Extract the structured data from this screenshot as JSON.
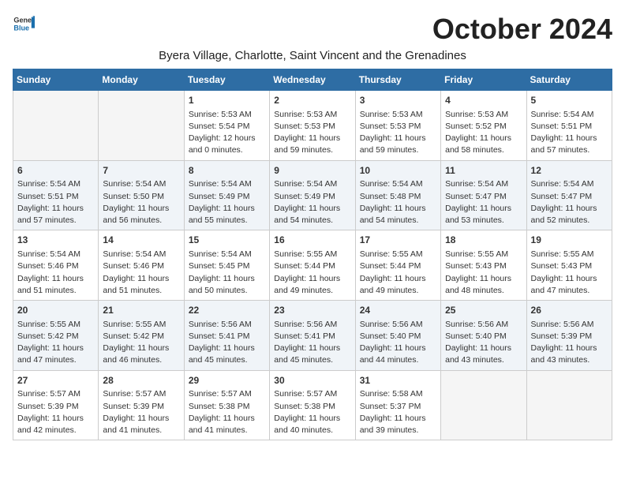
{
  "logo": {
    "general": "General",
    "blue": "Blue"
  },
  "title": "October 2024",
  "subtitle": "Byera Village, Charlotte, Saint Vincent and the Grenadines",
  "days_header": [
    "Sunday",
    "Monday",
    "Tuesday",
    "Wednesday",
    "Thursday",
    "Friday",
    "Saturday"
  ],
  "weeks": [
    [
      {
        "day": "",
        "info": ""
      },
      {
        "day": "",
        "info": ""
      },
      {
        "day": "1",
        "info": "Sunrise: 5:53 AM\nSunset: 5:54 PM\nDaylight: 12 hours and 0 minutes."
      },
      {
        "day": "2",
        "info": "Sunrise: 5:53 AM\nSunset: 5:53 PM\nDaylight: 11 hours and 59 minutes."
      },
      {
        "day": "3",
        "info": "Sunrise: 5:53 AM\nSunset: 5:53 PM\nDaylight: 11 hours and 59 minutes."
      },
      {
        "day": "4",
        "info": "Sunrise: 5:53 AM\nSunset: 5:52 PM\nDaylight: 11 hours and 58 minutes."
      },
      {
        "day": "5",
        "info": "Sunrise: 5:54 AM\nSunset: 5:51 PM\nDaylight: 11 hours and 57 minutes."
      }
    ],
    [
      {
        "day": "6",
        "info": "Sunrise: 5:54 AM\nSunset: 5:51 PM\nDaylight: 11 hours and 57 minutes."
      },
      {
        "day": "7",
        "info": "Sunrise: 5:54 AM\nSunset: 5:50 PM\nDaylight: 11 hours and 56 minutes."
      },
      {
        "day": "8",
        "info": "Sunrise: 5:54 AM\nSunset: 5:49 PM\nDaylight: 11 hours and 55 minutes."
      },
      {
        "day": "9",
        "info": "Sunrise: 5:54 AM\nSunset: 5:49 PM\nDaylight: 11 hours and 54 minutes."
      },
      {
        "day": "10",
        "info": "Sunrise: 5:54 AM\nSunset: 5:48 PM\nDaylight: 11 hours and 54 minutes."
      },
      {
        "day": "11",
        "info": "Sunrise: 5:54 AM\nSunset: 5:47 PM\nDaylight: 11 hours and 53 minutes."
      },
      {
        "day": "12",
        "info": "Sunrise: 5:54 AM\nSunset: 5:47 PM\nDaylight: 11 hours and 52 minutes."
      }
    ],
    [
      {
        "day": "13",
        "info": "Sunrise: 5:54 AM\nSunset: 5:46 PM\nDaylight: 11 hours and 51 minutes."
      },
      {
        "day": "14",
        "info": "Sunrise: 5:54 AM\nSunset: 5:46 PM\nDaylight: 11 hours and 51 minutes."
      },
      {
        "day": "15",
        "info": "Sunrise: 5:54 AM\nSunset: 5:45 PM\nDaylight: 11 hours and 50 minutes."
      },
      {
        "day": "16",
        "info": "Sunrise: 5:55 AM\nSunset: 5:44 PM\nDaylight: 11 hours and 49 minutes."
      },
      {
        "day": "17",
        "info": "Sunrise: 5:55 AM\nSunset: 5:44 PM\nDaylight: 11 hours and 49 minutes."
      },
      {
        "day": "18",
        "info": "Sunrise: 5:55 AM\nSunset: 5:43 PM\nDaylight: 11 hours and 48 minutes."
      },
      {
        "day": "19",
        "info": "Sunrise: 5:55 AM\nSunset: 5:43 PM\nDaylight: 11 hours and 47 minutes."
      }
    ],
    [
      {
        "day": "20",
        "info": "Sunrise: 5:55 AM\nSunset: 5:42 PM\nDaylight: 11 hours and 47 minutes."
      },
      {
        "day": "21",
        "info": "Sunrise: 5:55 AM\nSunset: 5:42 PM\nDaylight: 11 hours and 46 minutes."
      },
      {
        "day": "22",
        "info": "Sunrise: 5:56 AM\nSunset: 5:41 PM\nDaylight: 11 hours and 45 minutes."
      },
      {
        "day": "23",
        "info": "Sunrise: 5:56 AM\nSunset: 5:41 PM\nDaylight: 11 hours and 45 minutes."
      },
      {
        "day": "24",
        "info": "Sunrise: 5:56 AM\nSunset: 5:40 PM\nDaylight: 11 hours and 44 minutes."
      },
      {
        "day": "25",
        "info": "Sunrise: 5:56 AM\nSunset: 5:40 PM\nDaylight: 11 hours and 43 minutes."
      },
      {
        "day": "26",
        "info": "Sunrise: 5:56 AM\nSunset: 5:39 PM\nDaylight: 11 hours and 43 minutes."
      }
    ],
    [
      {
        "day": "27",
        "info": "Sunrise: 5:57 AM\nSunset: 5:39 PM\nDaylight: 11 hours and 42 minutes."
      },
      {
        "day": "28",
        "info": "Sunrise: 5:57 AM\nSunset: 5:39 PM\nDaylight: 11 hours and 41 minutes."
      },
      {
        "day": "29",
        "info": "Sunrise: 5:57 AM\nSunset: 5:38 PM\nDaylight: 11 hours and 41 minutes."
      },
      {
        "day": "30",
        "info": "Sunrise: 5:57 AM\nSunset: 5:38 PM\nDaylight: 11 hours and 40 minutes."
      },
      {
        "day": "31",
        "info": "Sunrise: 5:58 AM\nSunset: 5:37 PM\nDaylight: 11 hours and 39 minutes."
      },
      {
        "day": "",
        "info": ""
      },
      {
        "day": "",
        "info": ""
      }
    ]
  ]
}
